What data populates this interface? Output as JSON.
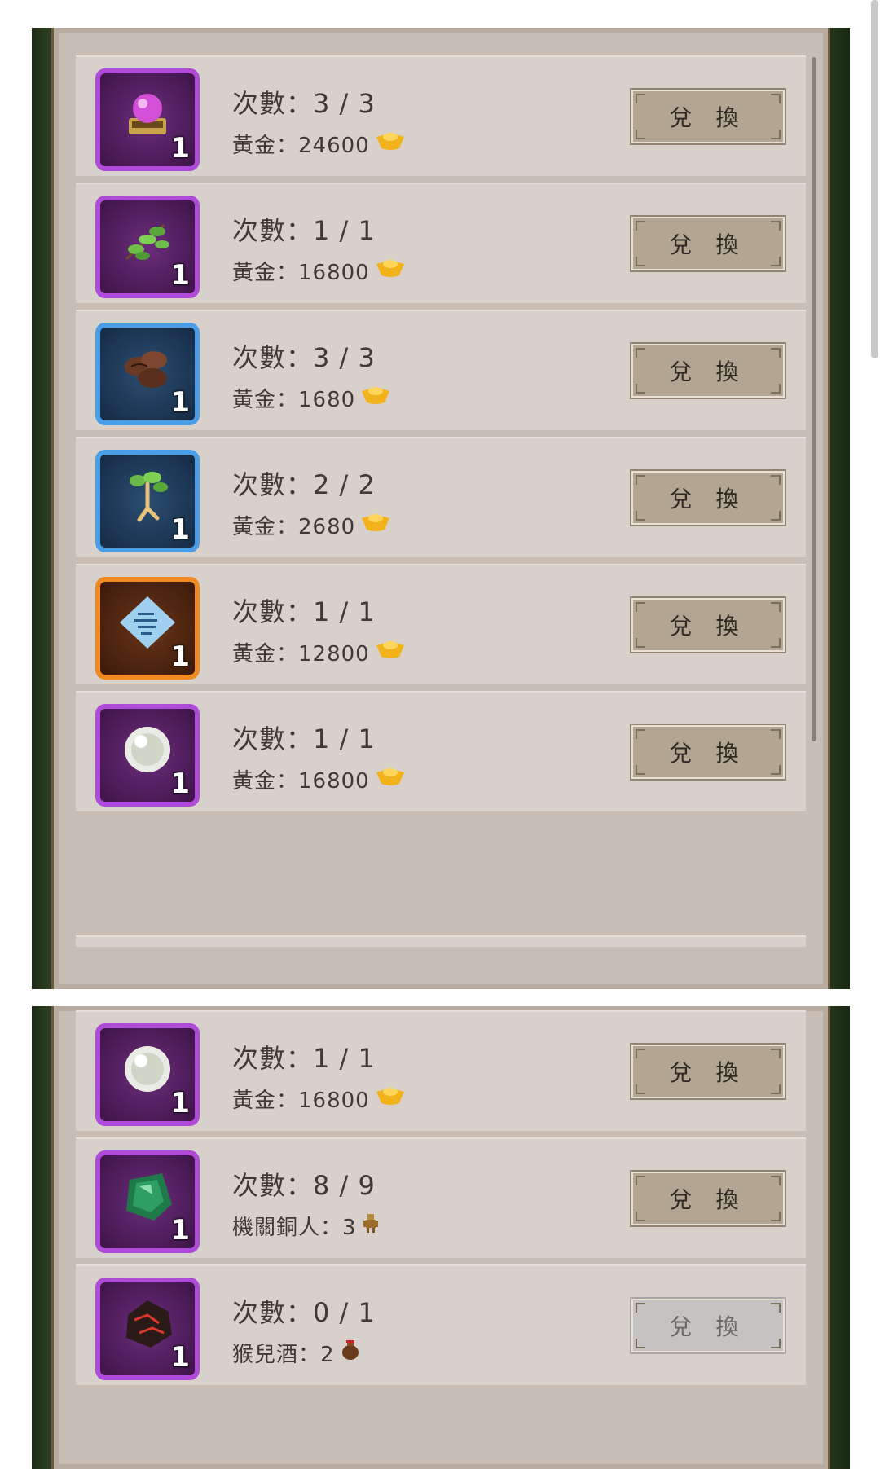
{
  "exchange_label": "兌 換",
  "list_a": [
    {
      "item_icon": "purple-orb-on-stand-icon",
      "rarity": "purple",
      "qty": "1",
      "times": "次數：3 / 3",
      "cost": "黃金：24600",
      "currency_icon": "gold-ingot-icon",
      "enabled": true
    },
    {
      "item_icon": "green-herb-sprig-icon",
      "rarity": "purple",
      "qty": "1",
      "times": "次數：1 / 1",
      "cost": "黃金：16800",
      "currency_icon": "gold-ingot-icon",
      "enabled": true
    },
    {
      "item_icon": "brown-seeds-icon",
      "rarity": "blue",
      "qty": "1",
      "times": "次數：3 / 3",
      "cost": "黃金：1680",
      "currency_icon": "gold-ingot-icon",
      "enabled": true
    },
    {
      "item_icon": "ginseng-root-icon",
      "rarity": "blue",
      "qty": "1",
      "times": "次數：2 / 2",
      "cost": "黃金：2680",
      "currency_icon": "gold-ingot-icon",
      "enabled": true
    },
    {
      "item_icon": "blue-scroll-icon",
      "rarity": "orange",
      "qty": "1",
      "times": "次數：1 / 1",
      "cost": "黃金：12800",
      "currency_icon": "gold-ingot-icon",
      "enabled": true
    },
    {
      "item_icon": "white-jade-pearl-icon",
      "rarity": "purple",
      "qty": "1",
      "times": "次數：1 / 1",
      "cost": "黃金：16800",
      "currency_icon": "gold-ingot-icon",
      "enabled": true
    }
  ],
  "list_b": [
    {
      "item_icon": "white-jade-pearl-icon",
      "rarity": "purple",
      "qty": "1",
      "times": "次數：1 / 1",
      "cost": "黃金：16800",
      "currency_icon": "gold-ingot-icon",
      "enabled": true
    },
    {
      "item_icon": "green-jade-stone-icon",
      "rarity": "purple",
      "qty": "1",
      "times": "次數：8 / 9",
      "cost": "機關銅人：3",
      "currency_icon": "bronze-figure-icon",
      "enabled": true
    },
    {
      "item_icon": "lava-rock-icon",
      "rarity": "purple",
      "qty": "1",
      "times": "次數：0 / 1",
      "cost": "猴兒酒：2",
      "currency_icon": "wine-jar-icon",
      "enabled": false
    }
  ]
}
